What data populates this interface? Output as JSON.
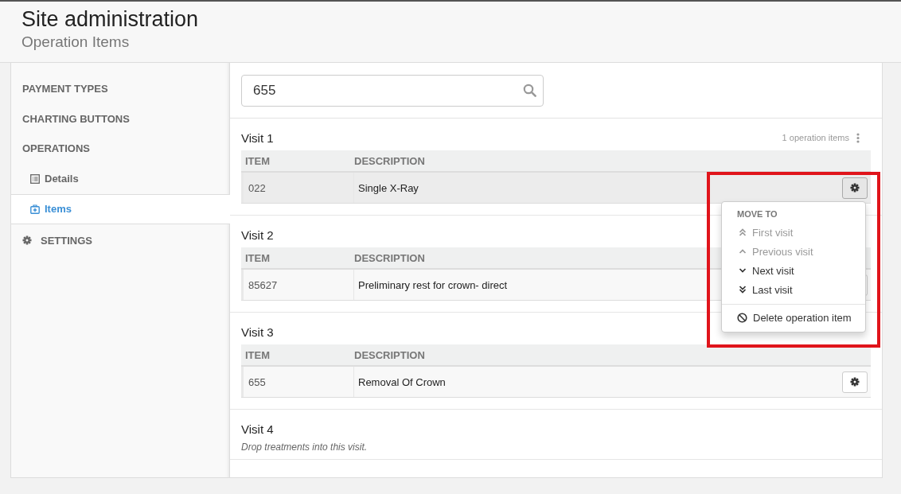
{
  "header": {
    "title": "Site administration",
    "subtitle": "Operation Items"
  },
  "sidebar": {
    "items": [
      {
        "label": "PAYMENT TYPES",
        "kind": "section"
      },
      {
        "label": "CHARTING BUTTONS",
        "kind": "section"
      },
      {
        "label": "OPERATIONS",
        "kind": "section"
      },
      {
        "label": "Details",
        "kind": "sub",
        "selected": false
      },
      {
        "label": "Items",
        "kind": "sub",
        "selected": true
      },
      {
        "label": "SETTINGS",
        "kind": "settings"
      }
    ]
  },
  "search": {
    "value": "655"
  },
  "visits": [
    {
      "title": "Visit 1",
      "count": "1 operation items",
      "columns": [
        "ITEM",
        "DESCRIPTION"
      ],
      "rows": [
        {
          "item": "022",
          "description": "Single X-Ray",
          "active": true
        }
      ]
    },
    {
      "title": "Visit 2",
      "columns": [
        "ITEM",
        "DESCRIPTION"
      ],
      "rows": [
        {
          "item": "85627",
          "description": "Preliminary rest for crown- direct",
          "active": false
        }
      ]
    },
    {
      "title": "Visit 3",
      "columns": [
        "ITEM",
        "DESCRIPTION"
      ],
      "rows": [
        {
          "item": "655",
          "description": "Removal Of Crown",
          "active": false
        }
      ]
    },
    {
      "title": "Visit 4",
      "empty_note": "Drop treatments into this visit."
    }
  ],
  "menu": {
    "heading": "MOVE TO",
    "items": [
      {
        "label": "First visit",
        "disabled": true
      },
      {
        "label": "Previous visit",
        "disabled": true
      },
      {
        "label": "Next visit",
        "disabled": false
      },
      {
        "label": "Last visit",
        "disabled": false
      }
    ],
    "delete_label": "Delete operation item"
  }
}
